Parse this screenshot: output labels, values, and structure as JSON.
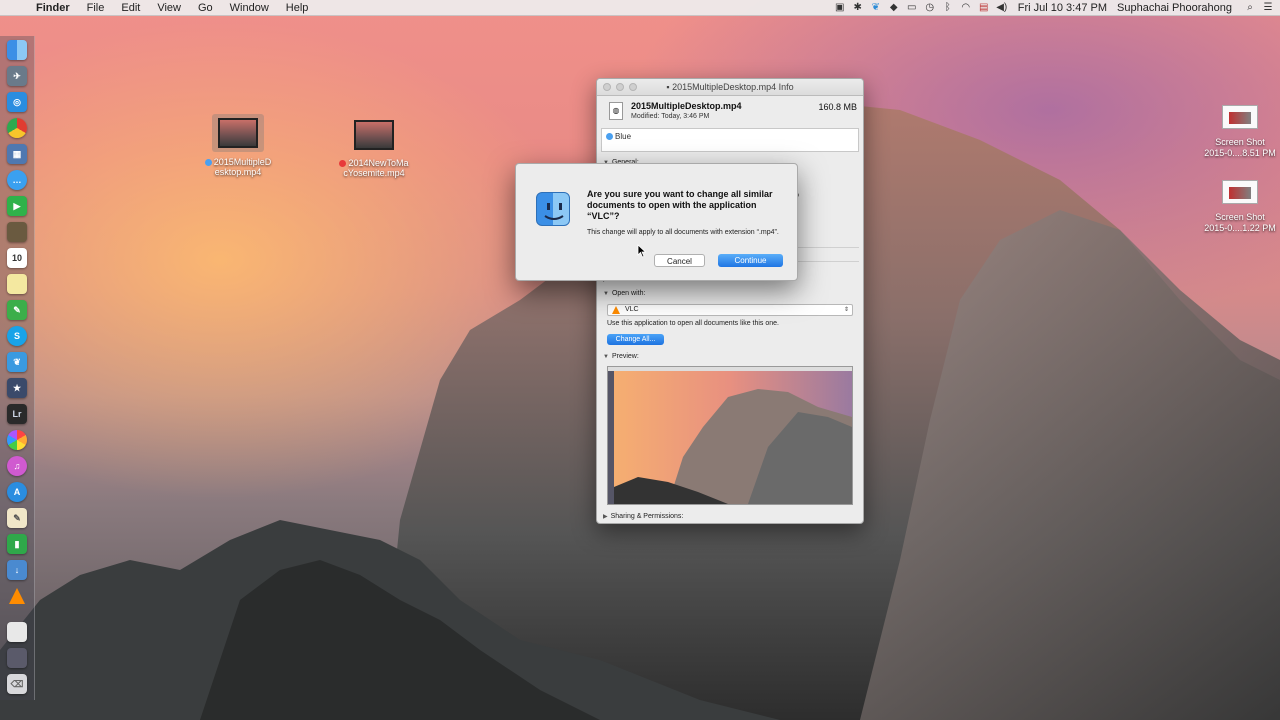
{
  "menubar": {
    "apple_icon": "apple-icon",
    "app_name": "Finder",
    "items": [
      "File",
      "Edit",
      "View",
      "Go",
      "Window",
      "Help"
    ],
    "clock": "Fri Jul 10  3:47 PM",
    "user": "Suphachai Phoorahong"
  },
  "desktop": {
    "files": [
      {
        "name": "2015MultipleDesktop.mp4",
        "label_line1": "2015MultipleD",
        "label_line2": "esktop.mp4",
        "tag_color": "#4aa0f0"
      },
      {
        "name": "2014NewToMacYosemite.mp4",
        "label_line1": "2014NewToMa",
        "label_line2": "cYosemite.mp4",
        "tag_color": "#e83a3a"
      }
    ],
    "screenshots": [
      {
        "label_line1": "Screen Shot",
        "label_line2": "2015-0....8.51 PM"
      },
      {
        "label_line1": "Screen Shot",
        "label_line2": "2015-0....1.22 PM"
      }
    ]
  },
  "info_window": {
    "title": "2015MultipleDesktop.mp4 Info",
    "file_name": "2015MultipleDesktop.mp4",
    "file_size": "160.8 MB",
    "modified": "Modified: Today, 3:46 PM",
    "tag": "Blue",
    "general_label": "General:",
    "partial_text": "p",
    "comments_label": "Comments:",
    "open_with_label": "Open with:",
    "open_with_app": "VLC",
    "open_with_note": "Use this application to open all documents like this one.",
    "change_all_label": "Change All...",
    "preview_label": "Preview:",
    "sharing_label": "Sharing & Permissions:"
  },
  "alert": {
    "message": "Are you sure you want to change all similar documents to open with the application “VLC”?",
    "info": "This change will apply to all documents with extension “.mp4”.",
    "cancel_label": "Cancel",
    "continue_label": "Continue"
  },
  "colors": {
    "accent_blue": "#1f75e3",
    "tag_blue": "#4aa0f0",
    "tag_red": "#e83a3a"
  }
}
